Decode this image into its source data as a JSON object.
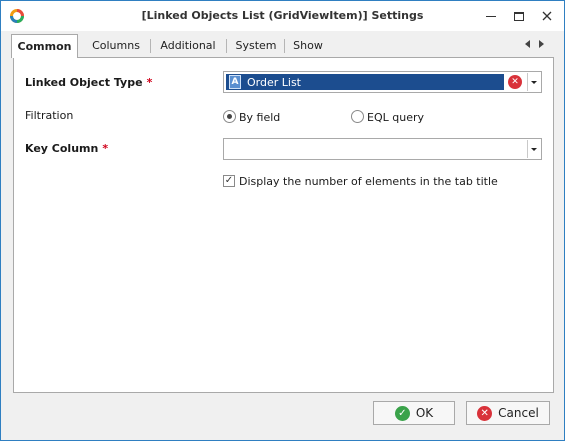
{
  "window": {
    "title": "[Linked Objects List (GridViewItem)] Settings",
    "icons": {
      "app": "app-logo-icon",
      "minimize": "minimize-icon",
      "maximize": "maximize-icon",
      "close": "close-icon"
    }
  },
  "tabs": [
    {
      "label": "Common",
      "active": true
    },
    {
      "label": "Columns",
      "active": false
    },
    {
      "label": "Additional",
      "active": false
    },
    {
      "label": "System",
      "active": false
    },
    {
      "label": "Show",
      "active": false
    }
  ],
  "form": {
    "linked_object_type": {
      "label": "Linked Object Type",
      "required_mark": "*",
      "value": "Order List",
      "value_icon": "A"
    },
    "filtration": {
      "label": "Filtration",
      "options": [
        {
          "label": "By field",
          "selected": true
        },
        {
          "label": "EQL query",
          "selected": false
        }
      ]
    },
    "key_column": {
      "label": "Key Column",
      "required_mark": "*",
      "value": ""
    },
    "display_count": {
      "label": "Display the number of elements in the tab title",
      "checked": true,
      "check_glyph": "✓"
    }
  },
  "buttons": {
    "ok": {
      "label": "OK",
      "icon_glyph": "✓",
      "color": "#3aa34a"
    },
    "cancel": {
      "label": "Cancel",
      "icon_glyph": "✕",
      "color": "#d9323a"
    }
  },
  "colors": {
    "accent_border": "#2f7fc1",
    "selection": "#1c4d8f",
    "required": "#d0021b"
  }
}
